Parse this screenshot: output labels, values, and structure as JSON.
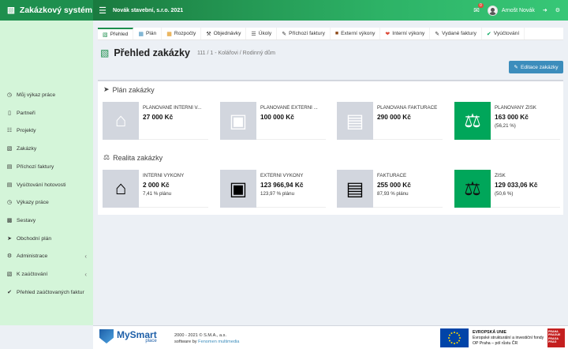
{
  "app": {
    "title": "Zakázkový systém",
    "company": "Novák stavební, s.r.o. 2021",
    "user": "Arnošt Novák",
    "notifications": "0"
  },
  "sidebar": {
    "items": [
      {
        "label": "Můj výkaz práce",
        "icon": "clock-icon"
      },
      {
        "label": "Partneři",
        "icon": "id-card-icon"
      },
      {
        "label": "Projekty",
        "icon": "sitemap-icon"
      },
      {
        "label": "Zakázky",
        "icon": "cube-icon"
      },
      {
        "label": "Příchozí faktury",
        "icon": "file-icon"
      },
      {
        "label": "Vyúčtování hotovosti",
        "icon": "file-icon"
      },
      {
        "label": "Výkazy práce",
        "icon": "clock-icon"
      },
      {
        "label": "Sestavy",
        "icon": "bar-chart-icon"
      },
      {
        "label": "Obchodní plán",
        "icon": "send-icon"
      },
      {
        "label": "Administrace",
        "icon": "gears-icon"
      },
      {
        "label": "K zaúčtování",
        "icon": "cube-icon"
      },
      {
        "label": "Přehled zaúčtovaných faktur",
        "icon": "check-circle-icon"
      }
    ]
  },
  "tabs": [
    {
      "label": "Přehled",
      "icon": "cube-icon"
    },
    {
      "label": "Plán",
      "icon": "table-icon"
    },
    {
      "label": "Rozpočty",
      "icon": "calculator-icon"
    },
    {
      "label": "Objednávky",
      "icon": "gavel-icon"
    },
    {
      "label": "Úkoly",
      "icon": "tasks-icon"
    },
    {
      "label": "Příchozí faktury",
      "icon": "pencil-icon"
    },
    {
      "label": "Externí výkony",
      "icon": "box-icon"
    },
    {
      "label": "Interní výkony",
      "icon": "heart-icon"
    },
    {
      "label": "Vydané faktury",
      "icon": "pencil-icon"
    },
    {
      "label": "Vyúčtování",
      "icon": "check-circle-icon"
    }
  ],
  "page": {
    "title": "Přehled zakázky",
    "subtitle": "111 / 1 - Kolářovi / Rodinný dům",
    "edit_button": "Editace zakázky"
  },
  "plan": {
    "title": "Plán zakázky",
    "boxes": [
      {
        "label": "Plánované interní v...",
        "value": "27 000 Kč",
        "extra": "",
        "icon": "home-icon"
      },
      {
        "label": "Plánované externí ...",
        "value": "100 000 Kč",
        "extra": "",
        "icon": "industry-icon"
      },
      {
        "label": "Plánovaná fakturace",
        "value": "290 000 Kč",
        "extra": "",
        "icon": "file-text-icon"
      },
      {
        "label": "Plánovaný zisk",
        "value": "163 000 Kč",
        "extra": "(56,21 %)",
        "icon": "balance-scale-icon"
      }
    ]
  },
  "reality": {
    "title": "Realita zakázky",
    "boxes": [
      {
        "label": "Interní výkony",
        "value": "2 000 Kč",
        "extra": "7,41 % plánu",
        "icon": "home-icon"
      },
      {
        "label": "Externí výkony",
        "value": "123 966,94 Kč",
        "extra": "123,97 % plánu",
        "icon": "industry-icon"
      },
      {
        "label": "Fakturace",
        "value": "255 000 Kč",
        "extra": "87,93 % plánu",
        "icon": "file-text-icon"
      },
      {
        "label": "Zisk",
        "value": "129 033,06 Kč",
        "extra": "(50,6 %)",
        "icon": "balance-scale-icon"
      }
    ]
  },
  "footer": {
    "logo_name": "MySmart",
    "logo_sub": "place",
    "copyright": "2000 - 2021 © S.M.A., a.s.",
    "software_by": "software by",
    "software_link": "Fenomen multimedia",
    "eu_line1": "EVROPSKÁ UNIE",
    "eu_line2": "Evropské strukturální a investiční fondy",
    "eu_line3": "OP Praha – pól růstu ČR",
    "praha_text": "PRAHA PRAGUE PRAGA PRAG"
  },
  "colors": {
    "brand_green": "#1e8f4e",
    "sidebar_bg": "#d4f5d9",
    "accent_blue": "#3c8dbc",
    "box_green": "#00a65a",
    "box_gray": "#d2d6de"
  }
}
